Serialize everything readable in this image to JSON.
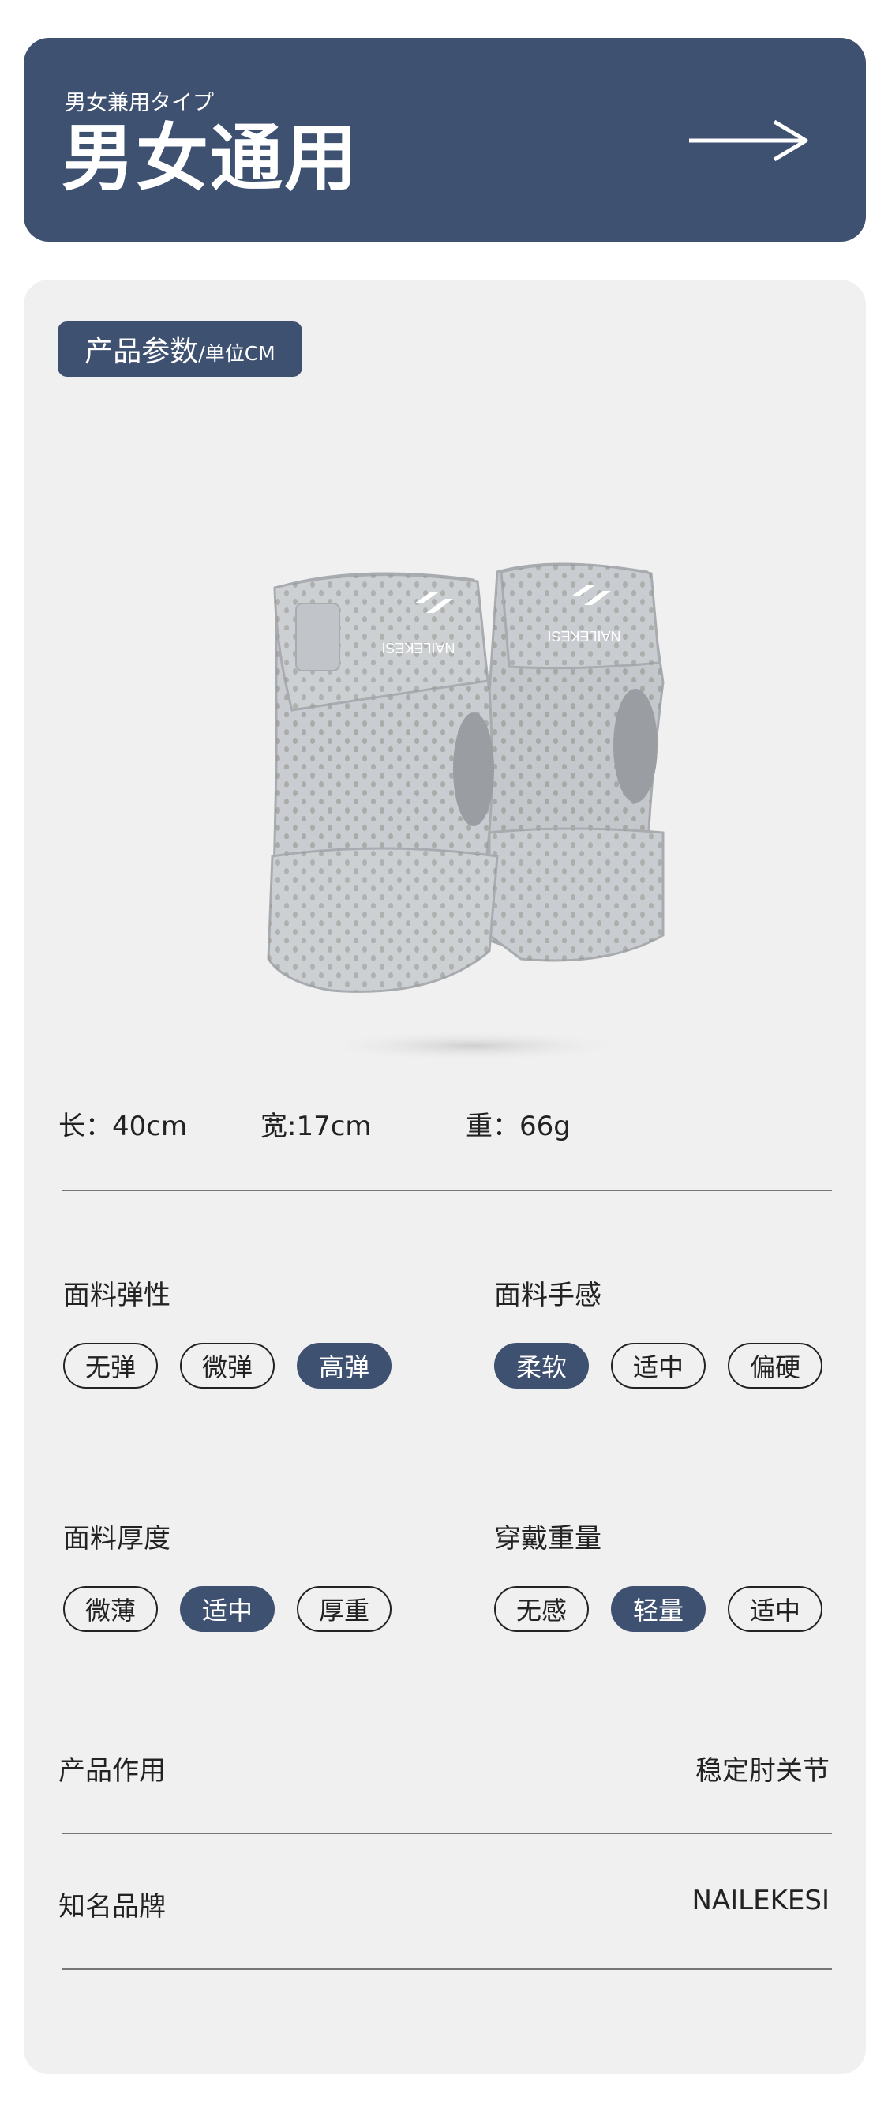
{
  "banner": {
    "subtitle": "男女兼用タイプ",
    "title": "男女通用"
  },
  "params": {
    "tag_main": "产品参数",
    "tag_unit": "/单位CM"
  },
  "product_image": {
    "brand_text": "NAILEKESI"
  },
  "dimensions": {
    "length": "长：40cm",
    "width": "宽:17cm",
    "weight": "重：66g"
  },
  "options": {
    "elasticity": {
      "label": "面料弹性",
      "choices": [
        "无弹",
        "微弹",
        "高弹"
      ],
      "selected": "高弹"
    },
    "feel": {
      "label": "面料手感",
      "choices": [
        "柔软",
        "适中",
        "偏硬"
      ],
      "selected": "柔软"
    },
    "thickness": {
      "label": "面料厚度",
      "choices": [
        "微薄",
        "适中",
        "厚重"
      ],
      "selected": "适中"
    },
    "wear_weight": {
      "label": "穿戴重量",
      "choices": [
        "无感",
        "轻量",
        "适中"
      ],
      "selected": "轻量"
    }
  },
  "info": {
    "function_label": "产品作用",
    "function_value": "稳定肘关节",
    "brand_label": "知名品牌",
    "brand_value": "NAILEKESI"
  },
  "colors": {
    "accent": "#3f5170",
    "card_bg": "#f0f0f0",
    "brace_gray": "#c4c7cb"
  }
}
